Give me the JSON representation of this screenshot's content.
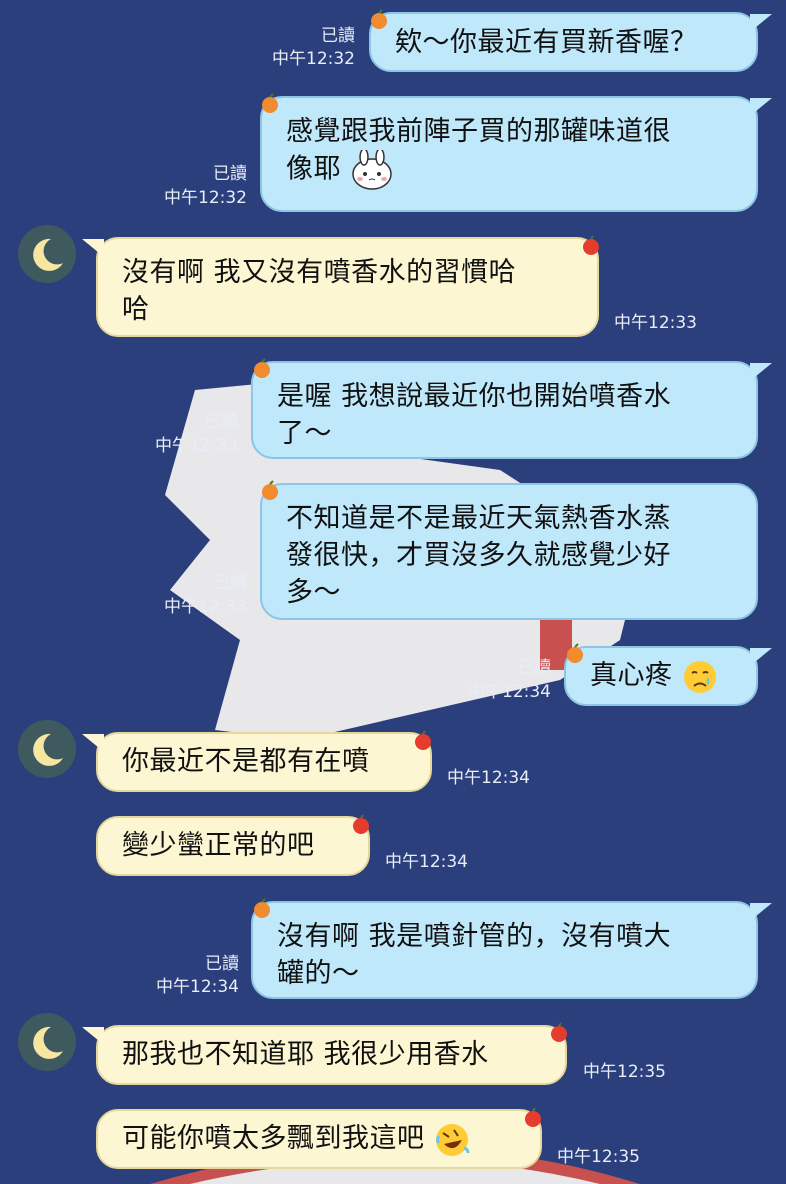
{
  "messages": [
    {
      "id": "m1",
      "side": "out",
      "lines": [
        "欸～你最近有買新香喔？"
      ],
      "read": "已讀",
      "time": "中午12:32"
    },
    {
      "id": "m2",
      "side": "out",
      "lines": [
        "感覺跟我前陣子買的那罐味道很",
        "像耶"
      ],
      "read": "已讀",
      "time": "中午12:32",
      "emoji": "bunny-sticker-emoji"
    },
    {
      "id": "m3",
      "side": "in",
      "lines": [
        "沒有啊 我又沒有噴香水的習慣哈",
        "哈"
      ],
      "time": "中午12:33"
    },
    {
      "id": "m4",
      "side": "out",
      "lines": [
        "是喔 我想說最近你也開始噴香水",
        "了～"
      ],
      "read": "已讀",
      "time": "中午12:33"
    },
    {
      "id": "m5",
      "side": "out",
      "lines": [
        "不知道是不是最近天氣熱香水蒸",
        "發很快，才買沒多久就感覺少好",
        "多～"
      ],
      "read": "已讀",
      "time": "中午12:33"
    },
    {
      "id": "m6",
      "side": "out",
      "lines": [
        "真心疼"
      ],
      "read": "已讀",
      "time": "中午12:34",
      "emoji": "crying-face-emoji"
    },
    {
      "id": "m7",
      "side": "in",
      "lines": [
        "你最近不是都有在噴"
      ],
      "time": "中午12:34"
    },
    {
      "id": "m8",
      "side": "in",
      "lines": [
        "變少蠻正常的吧"
      ],
      "time": "中午12:34"
    },
    {
      "id": "m9",
      "side": "out",
      "lines": [
        "沒有啊 我是噴針管的，沒有噴大",
        "罐的～"
      ],
      "read": "已讀",
      "time": "中午12:34"
    },
    {
      "id": "m10",
      "side": "in",
      "lines": [
        "那我也不知道耶 我很少用香水"
      ],
      "time": "中午12:35"
    },
    {
      "id": "m11",
      "side": "in",
      "lines": [
        "可能你噴太多飄到我這吧"
      ],
      "time": "中午12:35",
      "emoji": "rofl-emoji"
    }
  ],
  "colors": {
    "background": "#2b3f7d",
    "outgoing_bubble": "#bfe8fb",
    "incoming_bubble": "#fdf6d2",
    "meta_text": "#e8edf7"
  }
}
